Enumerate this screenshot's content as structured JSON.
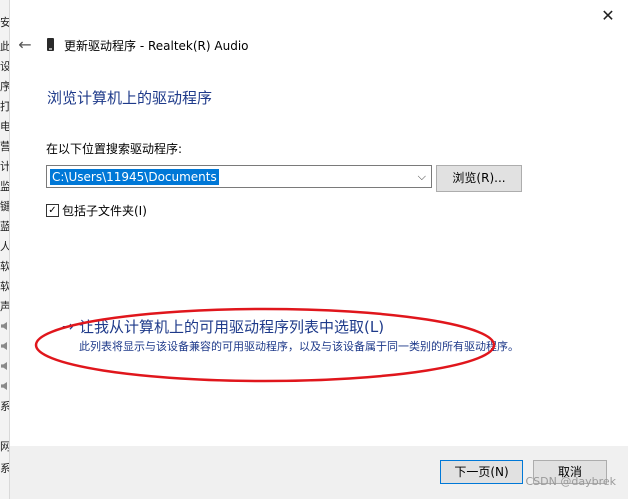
{
  "background_window": {
    "fragments": [
      "安",
      "此",
      "设",
      "序",
      "打",
      "电",
      "营",
      "计",
      "监",
      "键",
      "蓝",
      "人",
      "软",
      "软",
      "声",
      "系",
      "网",
      "系"
    ]
  },
  "dialog": {
    "title": "更新驱动程序 - Realtek(R) Audio",
    "heading": "浏览计算机上的驱动程序",
    "search_label": "在以下位置搜索驱动程序:",
    "path_value": "C:\\Users\\11945\\Documents",
    "browse_label": "浏览(R)...",
    "include_subfolders_label": "包括子文件夹(I)",
    "include_subfolders_checked": true,
    "pick_option_title": "让我从计算机上的可用驱动程序列表中选取(L)",
    "pick_option_desc": "此列表将显示与该设备兼容的可用驱动程序，以及与该设备属于同一类别的所有驱动程序。",
    "next_label": "下一页(N)",
    "cancel_label": "取消"
  },
  "watermark": "CSDN @daybrek",
  "colors": {
    "link_blue": "#1e3a8a",
    "selection_blue": "#0078d7",
    "annotation_red": "#e0161c",
    "footer_bg": "#f0f0f0"
  }
}
